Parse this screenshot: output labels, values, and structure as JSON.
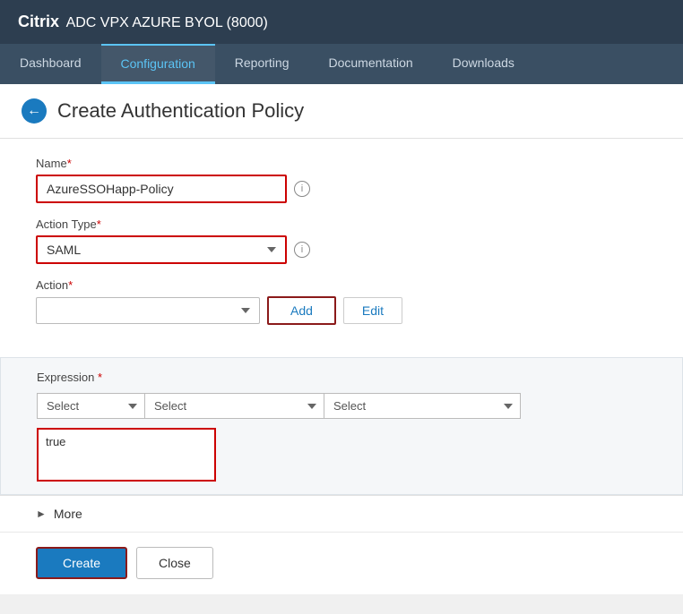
{
  "header": {
    "brand_bold": "Citrix",
    "brand_rest": " ADC VPX AZURE BYOL (8000)"
  },
  "nav": {
    "items": [
      {
        "label": "Dashboard",
        "active": false
      },
      {
        "label": "Configuration",
        "active": true
      },
      {
        "label": "Reporting",
        "active": false
      },
      {
        "label": "Documentation",
        "active": false
      },
      {
        "label": "Downloads",
        "active": false
      }
    ]
  },
  "page": {
    "title": "Create Authentication Policy",
    "back_label": "←"
  },
  "form": {
    "name_label": "Name",
    "name_value": "AzureSSOHapp-Policy",
    "action_type_label": "Action Type",
    "action_type_value": "SAML",
    "action_label": "Action",
    "add_button": "Add",
    "edit_button": "Edit",
    "expression_label": "Expression",
    "expression_select1": "Select",
    "expression_select2": "Select",
    "expression_select3": "Select",
    "expression_value": "true"
  },
  "more": {
    "label": "More"
  },
  "footer": {
    "create_button": "Create",
    "close_button": "Close"
  }
}
